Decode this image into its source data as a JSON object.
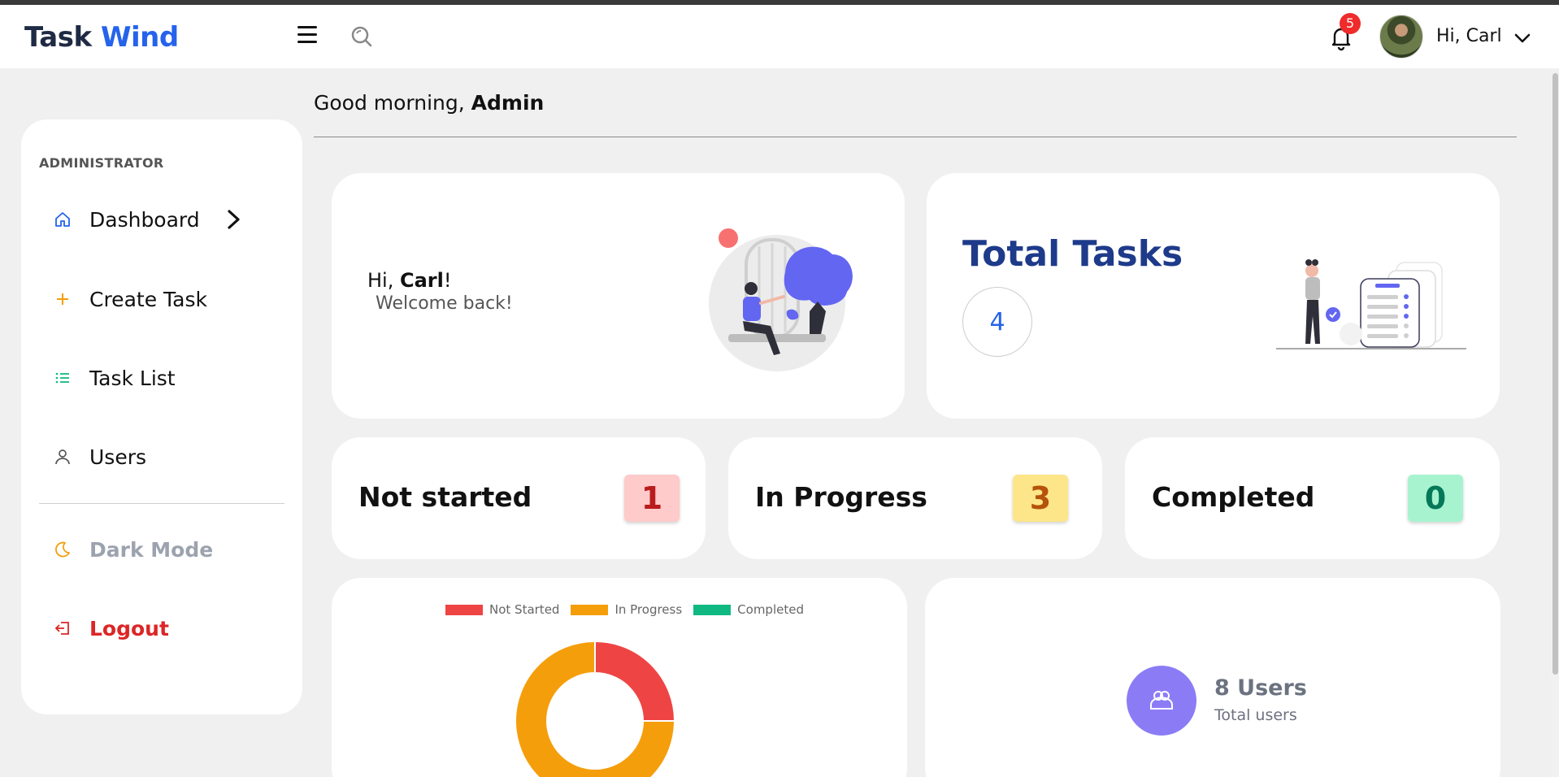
{
  "header": {
    "brand_part1": "Task",
    "brand_part2": "Wind",
    "notification_count": "5",
    "user_greeting": "Hi, Carl"
  },
  "sidebar": {
    "section_label": "ADMINISTRATOR",
    "items": [
      {
        "label": "Dashboard",
        "icon": "home-icon"
      },
      {
        "label": "Create Task",
        "icon": "plus-icon"
      },
      {
        "label": "Task List",
        "icon": "list-icon"
      },
      {
        "label": "Users",
        "icon": "user-icon"
      },
      {
        "label": "Dark Mode",
        "icon": "moon-icon"
      },
      {
        "label": "Logout",
        "icon": "logout-icon"
      }
    ]
  },
  "main": {
    "greeting_prefix": "Good morning,",
    "greeting_name": "Admin",
    "welcome": {
      "hi_prefix": "Hi,",
      "name": "Carl",
      "exclaim": "!",
      "subtitle": "Welcome back!"
    },
    "total_tasks": {
      "title": "Total Tasks",
      "value": "4"
    },
    "stats": [
      {
        "label": "Not started",
        "value": "1",
        "bg": "#fecaca",
        "fg": "#b91c1c"
      },
      {
        "label": "In Progress",
        "value": "3",
        "bg": "#fde68a",
        "fg": "#b45309"
      },
      {
        "label": "Completed",
        "value": "0",
        "bg": "#a7f3d0",
        "fg": "#047857"
      }
    ],
    "users": {
      "count_label": "8 Users",
      "subtitle": "Total users"
    }
  },
  "chart_data": {
    "type": "pie",
    "variant": "doughnut",
    "categories": [
      "Not Started",
      "In Progress",
      "Completed"
    ],
    "values": [
      1,
      3,
      0
    ],
    "colors": [
      "#ef4444",
      "#f59e0b",
      "#10b981"
    ],
    "legend": "top"
  },
  "colors": {
    "accent": "#2563eb",
    "brand_dark": "#1f2a44",
    "logout": "#dc2626",
    "dark_mode_text": "#9ca3af",
    "users_circle": "#8b7cf6"
  }
}
